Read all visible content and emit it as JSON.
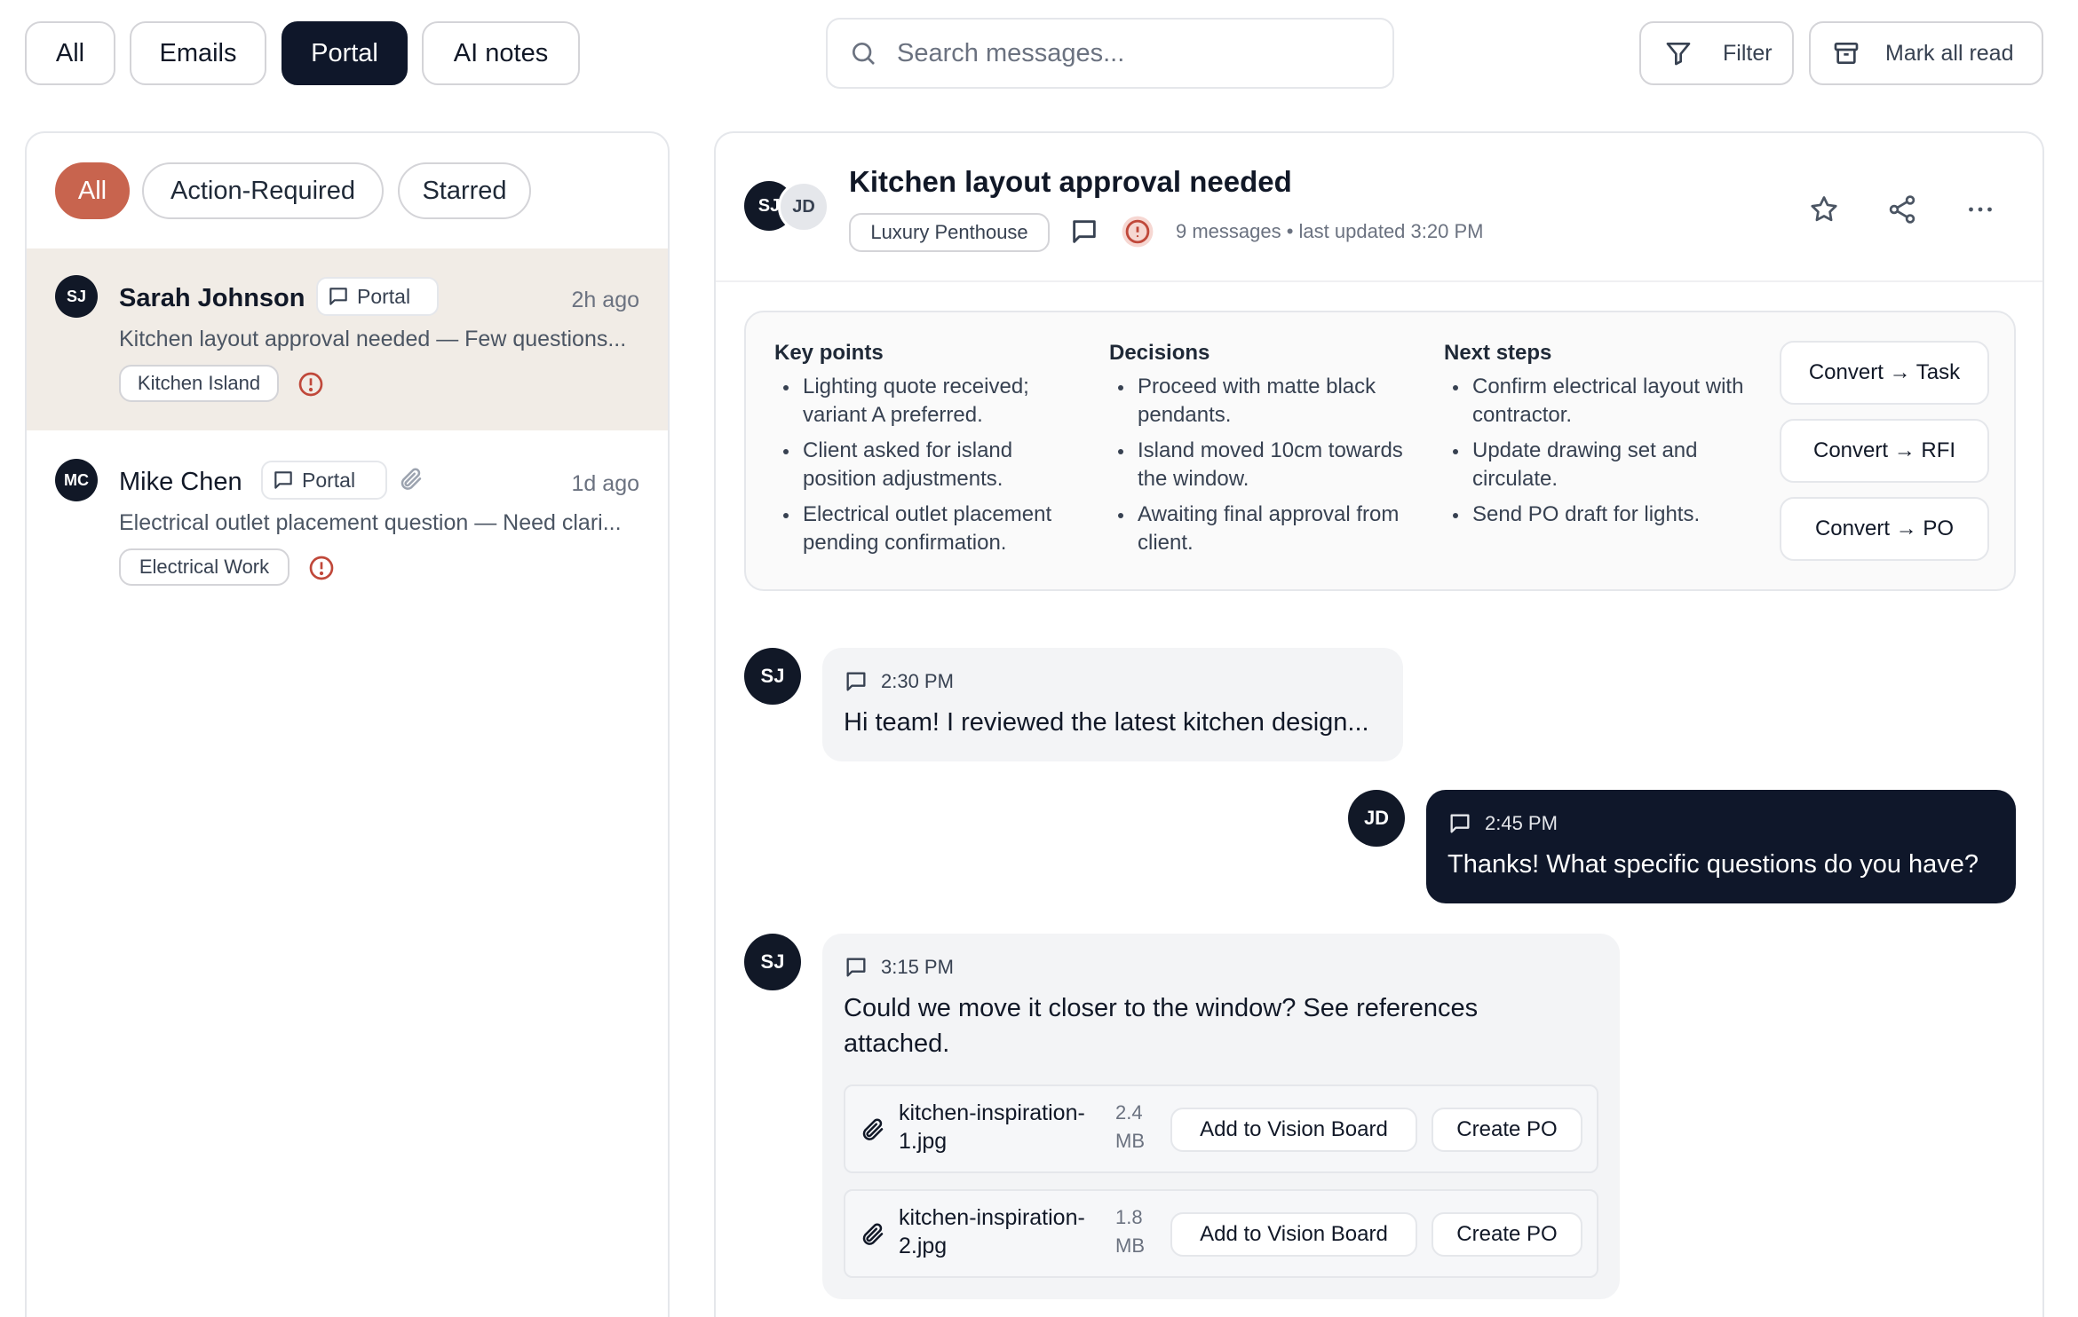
{
  "top_tabs": [
    "All",
    "Emails",
    "Portal",
    "AI notes"
  ],
  "search": {
    "placeholder": "Search messages..."
  },
  "toolbar": {
    "filter_label": "Filter",
    "mark_all_read_label": "Mark all read"
  },
  "inbox": {
    "filters": [
      "All",
      "Action-Required",
      "Starred"
    ],
    "conversations": [
      {
        "initials": "SJ",
        "name": "Sarah Johnson",
        "channel": "Portal",
        "time": "2h ago",
        "preview": "Kitchen layout approval needed — Few questions...",
        "tag": "Kitchen Island"
      },
      {
        "initials": "MC",
        "name": "Mike Chen",
        "channel": "Portal",
        "time": "1d ago",
        "preview": "Electrical outlet placement question — Need clari...",
        "tag": "Electrical Work"
      }
    ]
  },
  "thread": {
    "avatars": [
      "SJ",
      "JD"
    ],
    "title": "Kitchen layout approval needed",
    "project_tag": "Luxury Penthouse",
    "meta": "9 messages • last updated 3:20 PM",
    "summary": {
      "key_points": {
        "heading": "Key points",
        "items": [
          "Lighting quote received; variant A preferred.",
          "Client asked for island position adjustments.",
          "Electrical outlet placement pending confirmation."
        ]
      },
      "decisions": {
        "heading": "Decisions",
        "items": [
          "Proceed with matte black pendants.",
          "Island moved 10cm towards the window.",
          "Awaiting final approval from client."
        ]
      },
      "next_steps": {
        "heading": "Next steps",
        "items": [
          "Confirm electrical layout with contractor.",
          "Update drawing set and circulate.",
          "Send PO draft for lights."
        ]
      },
      "actions": [
        "Convert → Task",
        "Convert → RFI",
        "Convert → PO"
      ]
    },
    "messages": [
      {
        "initials": "SJ",
        "time": "2:30 PM",
        "text": "Hi team! I reviewed the latest kitchen design..."
      },
      {
        "initials": "JD",
        "time": "2:45 PM",
        "text": "Thanks! What specific questions do you have?"
      },
      {
        "initials": "SJ",
        "time": "3:15 PM",
        "text": "Could we move it closer to the window? See references attached.",
        "attachments": [
          {
            "name": "kitchen-inspiration-1.jpg",
            "size": "2.4 MB"
          },
          {
            "name": "kitchen-inspiration-2.jpg",
            "size": "1.8 MB"
          }
        ]
      }
    ],
    "attachment_actions": {
      "vision_board": "Add to Vision Board",
      "create_po": "Create PO"
    }
  },
  "colors": {
    "dark": "#0f172a",
    "accent": "#c8644e",
    "selected_row": "#f1ece6",
    "alert": "#c0483a"
  }
}
